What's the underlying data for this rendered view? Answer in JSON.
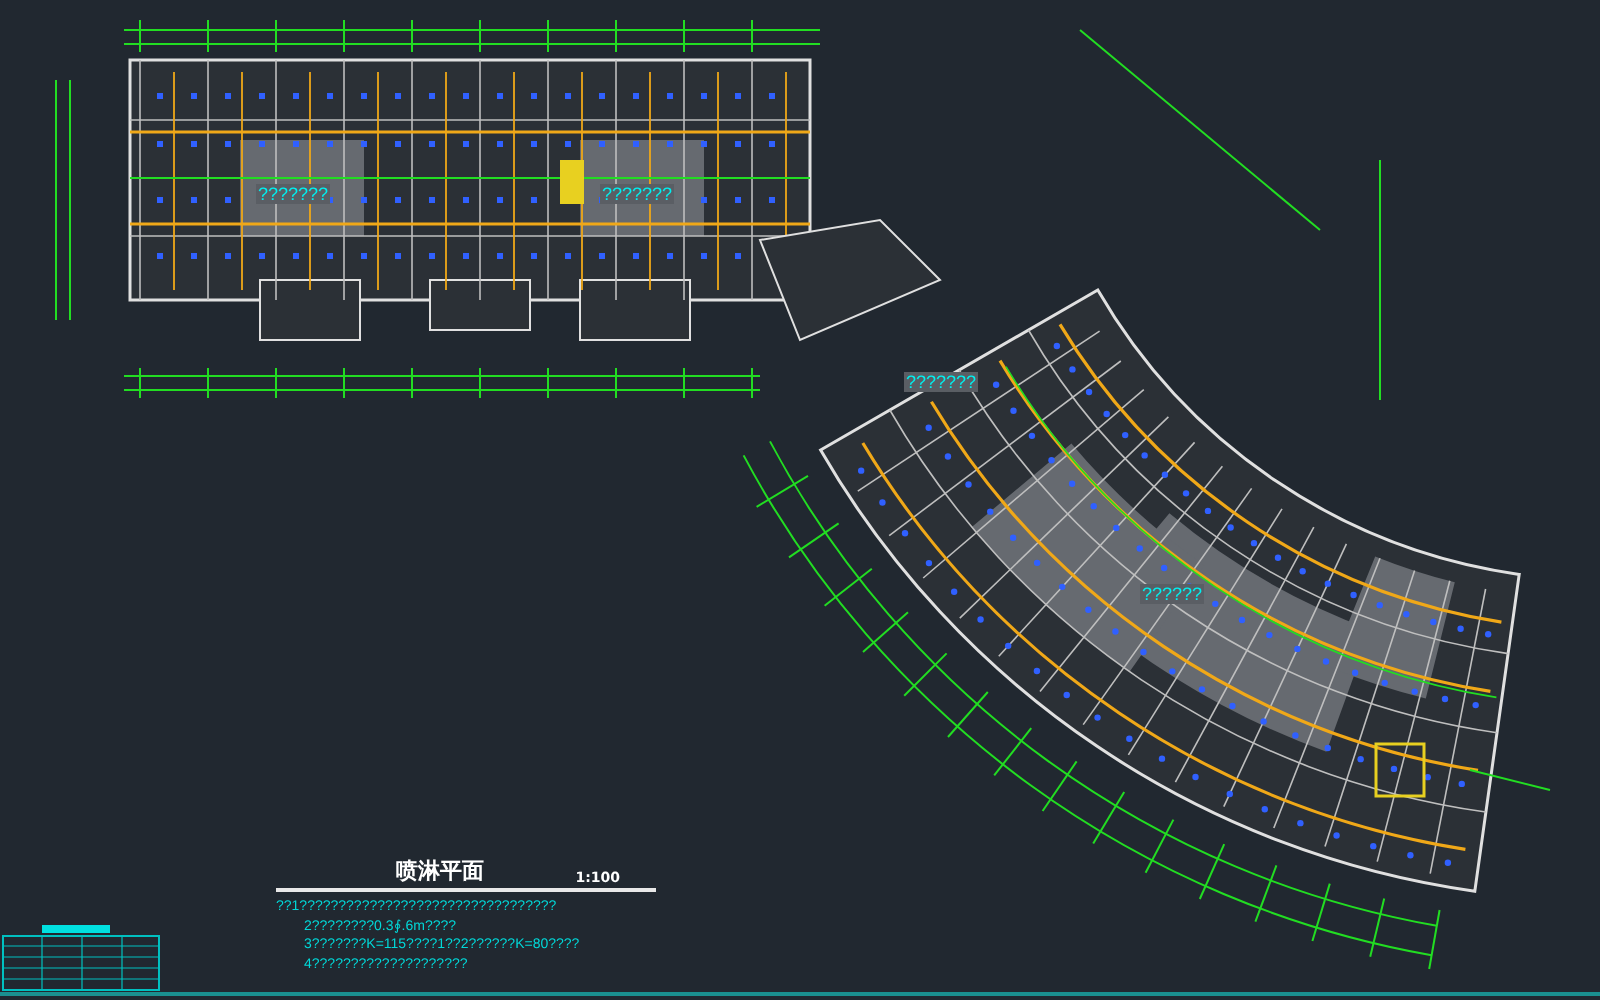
{
  "plan": {
    "room_labels": [
      "???????",
      "???????",
      "???????",
      "??????"
    ]
  },
  "title_block": {
    "title": "喷淋平面",
    "scale": "1:100",
    "notes": [
      "??1?????????????????????????????????",
      "2????????0.3∮.6m????",
      "3???????K=115????1??2??????K=80????",
      "4????????????????????"
    ]
  }
}
